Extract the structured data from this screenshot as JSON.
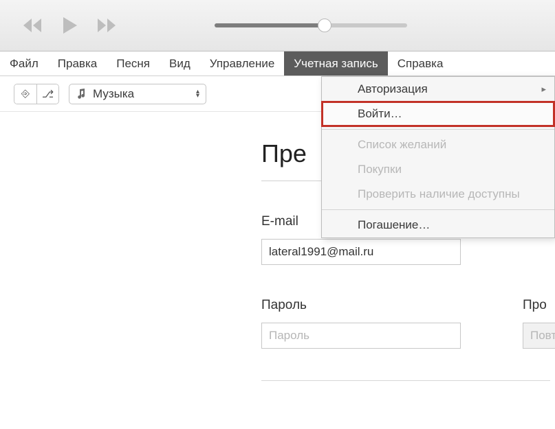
{
  "menubar": {
    "items": [
      {
        "label": "Файл"
      },
      {
        "label": "Правка"
      },
      {
        "label": "Песня"
      },
      {
        "label": "Вид"
      },
      {
        "label": "Управление"
      },
      {
        "label": "Учетная запись"
      },
      {
        "label": "Справка"
      }
    ],
    "active_index": 5
  },
  "toolbar": {
    "category_label": "Музыка"
  },
  "dropdown": {
    "items": [
      {
        "label": "Авторизация",
        "has_sub": true
      },
      {
        "label": "Войти…",
        "highlight": true
      },
      {
        "sep": true
      },
      {
        "label": "Список желаний",
        "disabled": true
      },
      {
        "label": "Покупки",
        "disabled": true
      },
      {
        "label": "Проверить наличие доступны",
        "disabled": true
      },
      {
        "sep": true
      },
      {
        "label": "Погашение…"
      }
    ]
  },
  "page": {
    "heading": "Пре",
    "email_label": "E-mail",
    "email_value": "lateral1991@mail.ru",
    "password_label": "Пароль",
    "password_placeholder": "Пароль",
    "confirm_label": "Про",
    "confirm_placeholder": "Повт"
  },
  "playback": {
    "progress_percent": 57
  }
}
